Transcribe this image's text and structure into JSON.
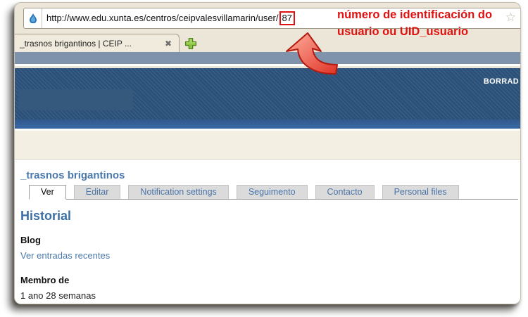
{
  "browser": {
    "address_bar": {
      "url_prefix": "http://www.edu.xunta.es/centros/ceipvalesvillamarin/user/",
      "uid": "87",
      "bookmark_star_glyph": "☆"
    },
    "tab_bar": {
      "tab_title": "_trasnos brigantinos | CEIP ...",
      "close_glyph": "✖"
    }
  },
  "annotation": {
    "text_line1": "número de identificación do",
    "text_line2": "usuario ou UID_usuario",
    "highlight_color": "#dd1111"
  },
  "webpage": {
    "banner_text": "BORRAD",
    "profile": {
      "title": "_trasnos brigantinos",
      "tabs": [
        {
          "label": "Ver",
          "active": true
        },
        {
          "label": "Editar",
          "active": false
        },
        {
          "label": "Notification settings",
          "active": false
        },
        {
          "label": "Seguimento",
          "active": false
        },
        {
          "label": "Contacto",
          "active": false
        },
        {
          "label": "Personal files",
          "active": false
        }
      ],
      "heading": "Historial",
      "blog_label": "Blog",
      "blog_link": "Ver entradas recentes",
      "member_label": "Membro de",
      "member_value": "1 ano 28 semanas"
    }
  },
  "colors": {
    "chrome_bg": "#ece6d8",
    "band_blue_gray": "#8093ac",
    "header_blue_dark": "#2d5176",
    "header_stripe": "#3a628e",
    "header_band_blue": "#36639b",
    "cream_band": "#f3f0e3",
    "link_blue": "#4a79ad",
    "heading_blue": "#3c6fa5",
    "annotation_red": "#e01111"
  }
}
